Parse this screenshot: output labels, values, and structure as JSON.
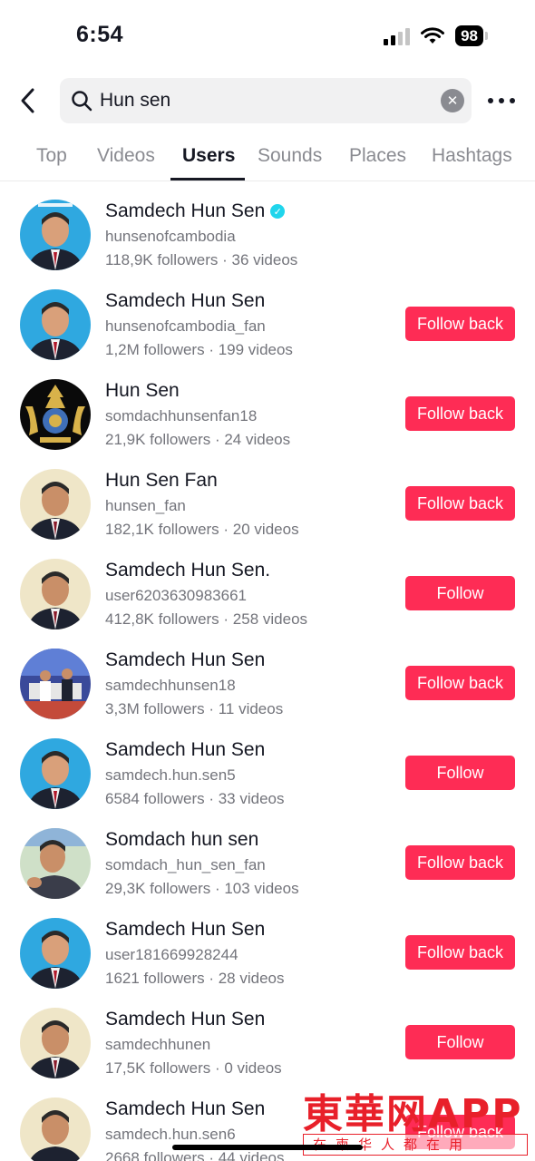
{
  "status_bar": {
    "time": "6:54",
    "battery": "98"
  },
  "search": {
    "query": "Hun sen",
    "clear_icon": "clear-icon",
    "more_icon": "more-dots-icon",
    "back_icon": "back-chevron-icon"
  },
  "tabs": [
    {
      "label": "Top"
    },
    {
      "label": "Videos"
    },
    {
      "label": "Users",
      "active": true
    },
    {
      "label": "Sounds"
    },
    {
      "label": "Places"
    },
    {
      "label": "Hashtags"
    }
  ],
  "colors": {
    "follow_button": "#fe2c55",
    "verified_badge": "#20d5ec",
    "avatar_bg_blue": "#2fa8e0",
    "avatar_bg_cream": "#efe6c8"
  },
  "users": [
    {
      "name": "Samdech Hun Sen",
      "verified": true,
      "handle": "hunsenofcambodia",
      "stats": "118,9K followers · 36 videos",
      "button": ""
    },
    {
      "name": "Samdech Hun Sen",
      "handle": "hunsenofcambodia_fan",
      "stats": "1,2M followers · 199 videos",
      "button": "Follow back"
    },
    {
      "name": "Hun Sen",
      "handle": "somdachhunsenfan18",
      "stats": "21,9K followers · 24 videos",
      "button": "Follow back"
    },
    {
      "name": "Hun Sen Fan",
      "handle": "hunsen_fan",
      "stats": "182,1K followers · 20 videos",
      "button": "Follow back"
    },
    {
      "name": "Samdech Hun Sen.",
      "handle": "user6203630983661",
      "stats": "412,8K followers · 258 videos",
      "button": "Follow"
    },
    {
      "name": "Samdech Hun Sen",
      "handle": "samdechhunsen18",
      "stats": "3,3M followers · 11 videos",
      "button": "Follow back"
    },
    {
      "name": "Samdech Hun Sen",
      "handle": "samdech.hun.sen5",
      "stats": "6584 followers · 33 videos",
      "button": "Follow"
    },
    {
      "name": "Somdach hun sen",
      "handle": "somdach_hun_sen_fan",
      "stats": "29,3K followers · 103 videos",
      "button": "Follow back"
    },
    {
      "name": "Samdech Hun Sen",
      "handle": "user181669928244",
      "stats": "1621 followers · 28 videos",
      "button": "Follow back"
    },
    {
      "name": "Samdech Hun Sen",
      "handle": "samdechhunen",
      "stats": "17,5K followers · 0 videos",
      "button": "Follow"
    },
    {
      "name": "Samdech Hun Sen",
      "handle": "samdech.hun.sen6",
      "stats": "2668 followers · 44 videos",
      "button": "Follow back"
    }
  ],
  "watermark": {
    "title": "東華网APP",
    "subtitle": "在柬华人都在用"
  }
}
